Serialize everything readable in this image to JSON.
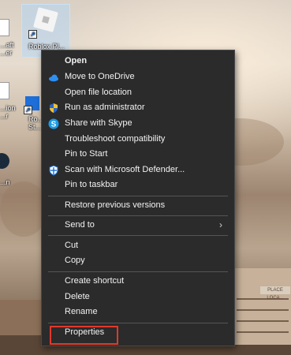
{
  "desktop": {
    "icons": [
      {
        "label": "Roblox Pl...",
        "icon": "roblox-icon"
      },
      {
        "label": "Ro... St...",
        "icon": "roblox-studio-icon"
      },
      {
        "label": "...aft ...er",
        "icon": "document-icon"
      },
      {
        "label": "...ion ...r",
        "icon": "document-icon"
      },
      {
        "label": "...n",
        "icon": "app-icon"
      }
    ],
    "sign_text": "PLACE LOCA..."
  },
  "context_menu": {
    "items": [
      {
        "label": "Open",
        "icon": "",
        "bold": true
      },
      {
        "label": "Move to OneDrive",
        "icon": "onedrive-icon"
      },
      {
        "label": "Open file location",
        "icon": ""
      },
      {
        "label": "Run as administrator",
        "icon": "shield-icon"
      },
      {
        "label": "Share with Skype",
        "icon": "skype-icon"
      },
      {
        "label": "Troubleshoot compatibility",
        "icon": ""
      },
      {
        "label": "Pin to Start",
        "icon": ""
      },
      {
        "label": "Scan with Microsoft Defender...",
        "icon": "defender-icon"
      },
      {
        "label": "Pin to taskbar",
        "icon": ""
      },
      {
        "label": "Restore previous versions",
        "icon": ""
      },
      {
        "label": "Send to",
        "icon": "",
        "submenu": true
      },
      {
        "label": "Cut",
        "icon": ""
      },
      {
        "label": "Copy",
        "icon": ""
      },
      {
        "label": "Create shortcut",
        "icon": ""
      },
      {
        "label": "Delete",
        "icon": ""
      },
      {
        "label": "Rename",
        "icon": ""
      },
      {
        "label": "Properties",
        "icon": "",
        "highlighted": true
      }
    ],
    "submenu_glyph": "›"
  },
  "colors": {
    "menu_bg": "#2b2b2b",
    "menu_text": "#f2f2f2",
    "highlight_border": "#e0392b"
  }
}
